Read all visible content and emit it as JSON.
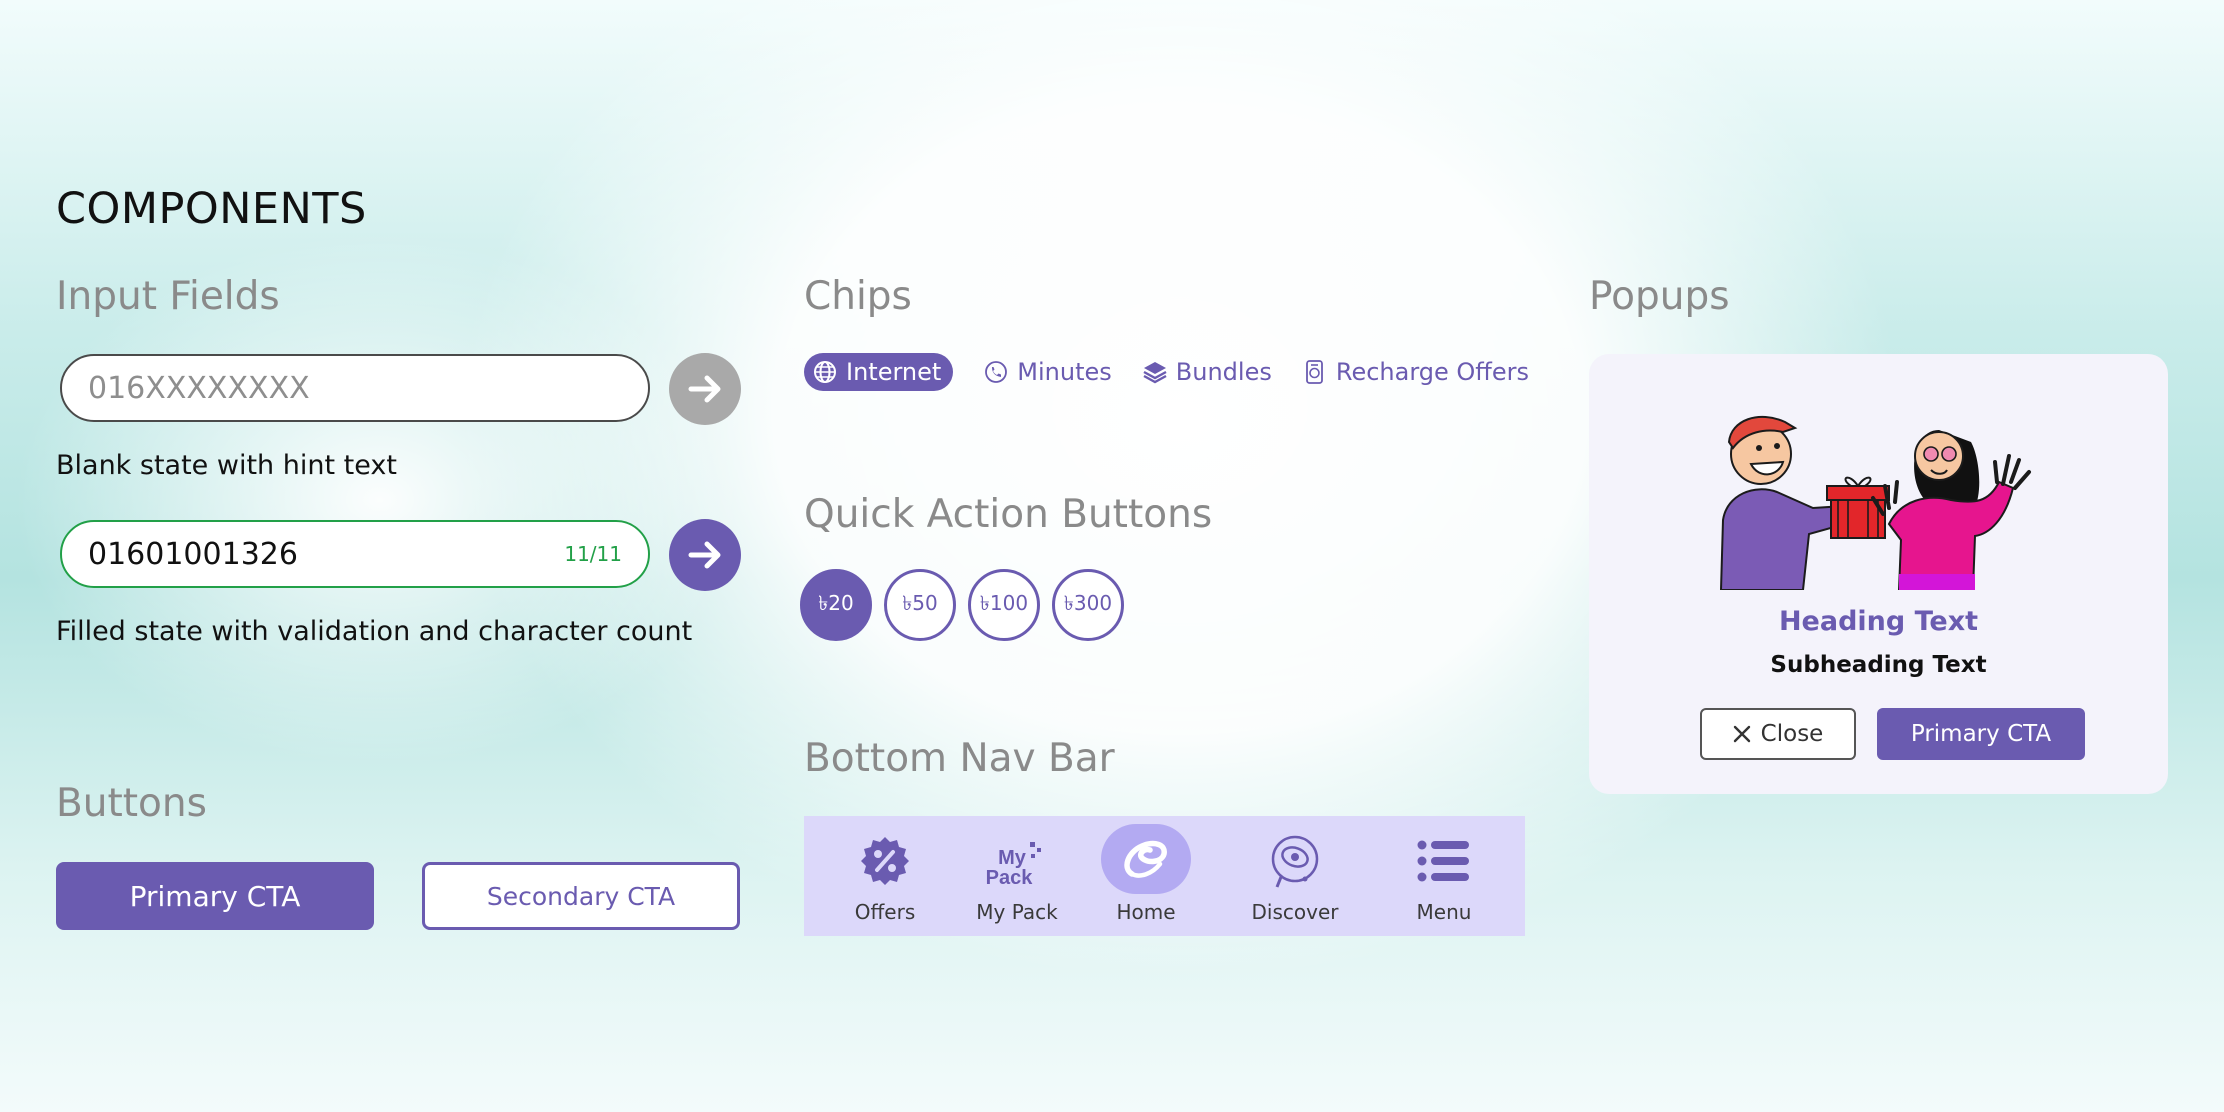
{
  "page": {
    "title": "COMPONENTS"
  },
  "colors": {
    "accent": "#6a5bb0",
    "success": "#22a048",
    "muted": "#a9a9a9",
    "nav_bg": "#dcd8fa",
    "nav_active": "#b3aaf2"
  },
  "input_fields": {
    "title": "Input Fields",
    "blank": {
      "placeholder": "016XXXXXXXX",
      "caption": "Blank state with hint text",
      "submit_icon": "arrow-right-icon"
    },
    "filled": {
      "value": "01601001326",
      "counter": "11/11",
      "caption": "Filled state with validation and character count",
      "submit_icon": "arrow-right-icon"
    }
  },
  "buttons": {
    "title": "Buttons",
    "primary": "Primary CTA",
    "secondary": "Secondary CTA"
  },
  "chips": {
    "title": "Chips",
    "items": [
      {
        "label": "Internet",
        "icon": "globe-icon",
        "active": true
      },
      {
        "label": "Minutes",
        "icon": "phone-icon",
        "active": false
      },
      {
        "label": "Bundles",
        "icon": "layers-icon",
        "active": false
      },
      {
        "label": "Recharge Offers",
        "icon": "recharge-icon",
        "active": false
      }
    ]
  },
  "quick_actions": {
    "title": "Quick Action Buttons",
    "items": [
      {
        "label": "৳20",
        "active": true
      },
      {
        "label": "৳50",
        "active": false
      },
      {
        "label": "৳100",
        "active": false
      },
      {
        "label": "৳300",
        "active": false
      }
    ]
  },
  "bottom_nav": {
    "title": "Bottom Nav Bar",
    "items": [
      {
        "label": "Offers",
        "icon": "offers-badge-icon",
        "active": false
      },
      {
        "label": "My Pack",
        "icon": "my-pack-icon",
        "icon_text": "My Pack",
        "active": false
      },
      {
        "label": "Home",
        "icon": "airtel-logo-icon",
        "active": true
      },
      {
        "label": "Discover",
        "icon": "discover-orbit-icon",
        "active": false
      },
      {
        "label": "Menu",
        "icon": "menu-list-icon",
        "active": false
      }
    ]
  },
  "popups": {
    "title": "Popups",
    "heading": "Heading Text",
    "subheading": "Subheading Text",
    "close": "Close",
    "cta": "Primary CTA"
  }
}
